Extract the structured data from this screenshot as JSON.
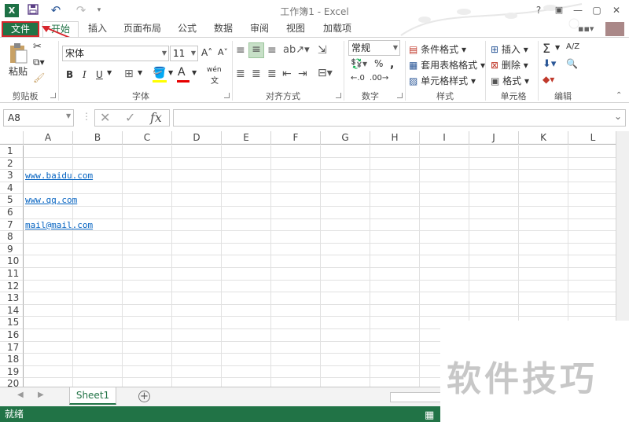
{
  "titlebar": {
    "title": "工作簿1 - Excel",
    "help": "?",
    "ribbon_opts": "▣",
    "minimize": "—",
    "restore": "▢",
    "close": "✕"
  },
  "quick_access": {
    "app_icon": "X",
    "save": "💾",
    "undo": "↶",
    "redo": "↷"
  },
  "tabs": [
    "文件",
    "开始",
    "插入",
    "页面布局",
    "公式",
    "数据",
    "审阅",
    "视图",
    "加载项"
  ],
  "ribbon": {
    "clipboard": {
      "paste": "粘贴",
      "label": "剪贴板"
    },
    "font": {
      "name": "宋体",
      "size": "11",
      "bold": "B",
      "italic": "I",
      "underline": "U",
      "grow": "A˄",
      "shrink": "A˅",
      "phonetic": "wén",
      "label": "字体"
    },
    "alignment": {
      "label": "对齐方式"
    },
    "number": {
      "format": "常规",
      "percent": "%",
      "comma": ",",
      "label": "数字"
    },
    "styles": {
      "conditional": "条件格式",
      "table": "套用表格格式",
      "cell": "单元格样式",
      "label": "样式"
    },
    "cells": {
      "insert": "插入",
      "delete": "删除",
      "format": "格式",
      "label": "单元格"
    },
    "editing": {
      "sum": "Σ",
      "sort": "A/Z",
      "find": "🔍",
      "label": "编辑"
    }
  },
  "formula_bar": {
    "name_box": "A8",
    "cancel": "✕",
    "enter": "✓",
    "fx": "fx",
    "value": ""
  },
  "columns": [
    "A",
    "B",
    "C",
    "D",
    "E",
    "F",
    "G",
    "H",
    "I",
    "J",
    "K",
    "L"
  ],
  "rows": [
    "1",
    "2",
    "3",
    "4",
    "5",
    "6",
    "7",
    "8",
    "9",
    "10",
    "11",
    "12",
    "13",
    "14",
    "15",
    "16",
    "17",
    "18",
    "19",
    "20"
  ],
  "cells": {
    "A3": "www.baidu.com",
    "A5": "www.qq.com",
    "A7": "mail@mail.com"
  },
  "sheet": {
    "tab": "Sheet1",
    "add": "+",
    "prev": "◀",
    "next": "▶"
  },
  "status": {
    "text": "就绪"
  },
  "watermark": "软件技巧",
  "colors": {
    "excel_green": "#217346",
    "annotation_red": "#d7262d",
    "link_blue": "#0563c1"
  }
}
